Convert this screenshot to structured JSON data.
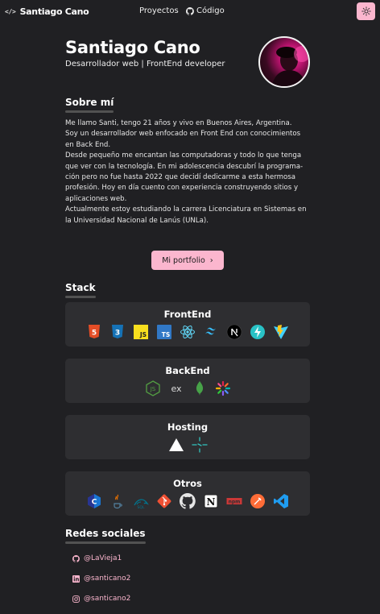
{
  "nav": {
    "brand": "Santiago Cano",
    "links": [
      {
        "label": "Proyectos",
        "icon": ""
      },
      {
        "label": "Código",
        "icon": "github-icon"
      }
    ],
    "theme_toggle_icon": "sun-icon"
  },
  "header": {
    "name": "Santiago Cano",
    "role": "Desarrollador web | FrontEnd developer"
  },
  "about": {
    "heading": "Sobre mí",
    "lines": [
      "Me llamo Santi, tengo 21 años y vivo en Buenos Aires, Argentina.",
      "Soy un desarrollador web enfocado en Front End con conocimientos",
      "en Back End.",
      "Desde pequeño me encantan las computadoras y todo lo que tenga",
      "que ver con la tecnología. En mi adolescencia descubrí la programa-",
      "ción pero no fue hasta 2022 que decidí dedicarme a esta hermosa",
      "profesión. Hoy en día cuento con experiencia construyendo sitios y",
      "aplicaciones web.",
      "Actualmente estoy estudiando la carrera Licenciatura en Sistemas en",
      "la Universidad Nacional de Lanús (UNLa)."
    ],
    "cta": "Mi portfolio",
    "cta_icon": "chevron-right-icon"
  },
  "stack": {
    "heading": "Stack",
    "groups": [
      {
        "title": "FrontEnd",
        "icons": [
          "html5-icon",
          "css3-icon",
          "javascript-icon",
          "typescript-icon",
          "react-icon",
          "tailwind-icon",
          "nextjs-icon",
          "astro-icon",
          "vite-icon"
        ]
      },
      {
        "title": "BackEnd",
        "icons": [
          "nodejs-icon",
          "express-icon",
          "mongodb-icon",
          "nestjs-icon"
        ]
      },
      {
        "title": "Hosting",
        "icons": [
          "vercel-icon",
          "netlify-icon"
        ]
      },
      {
        "title": "Otros",
        "icons": [
          "c-icon",
          "java-icon",
          "mysql-icon",
          "git-icon",
          "github-icon",
          "notion-icon",
          "npm-icon",
          "postman-icon",
          "vscode-icon"
        ]
      }
    ]
  },
  "social": {
    "heading": "Redes sociales",
    "links": [
      {
        "label": "@LaVieja1",
        "icon": "github-icon"
      },
      {
        "label": "@santicano2",
        "icon": "linkedin-icon"
      },
      {
        "label": "@santicano2",
        "icon": "instagram-icon"
      }
    ]
  },
  "colors": {
    "background": "#202023",
    "card": "#2e2e31",
    "accent": "#fbb6ce"
  }
}
